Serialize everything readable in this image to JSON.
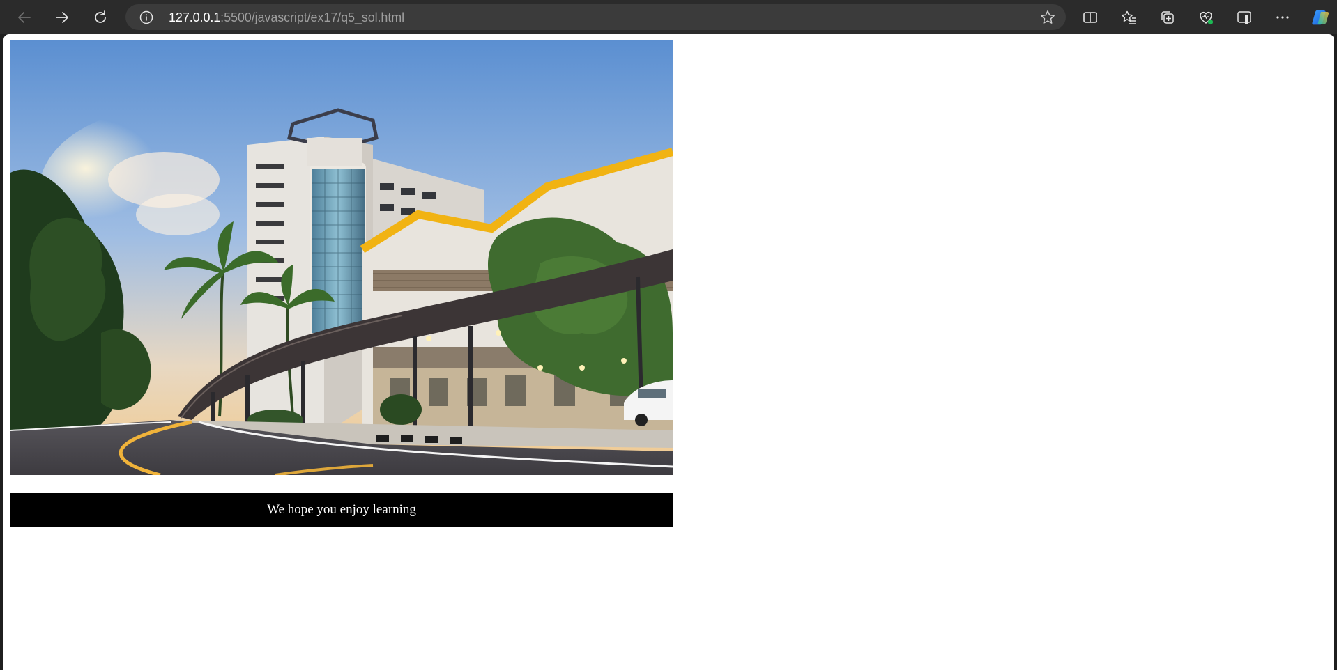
{
  "browser": {
    "url_host": "127.0.0.1",
    "url_path": ":5500/javascript/ex17/q5_sol.html",
    "icons": [
      "back-icon",
      "forward-icon",
      "refresh-icon",
      "info-icon",
      "star-icon",
      "split-screen-icon",
      "favorites-icon",
      "collections-icon",
      "browser-essentials-icon",
      "reading-view-icon",
      "more-icon",
      "copilot-icon"
    ],
    "colors": {
      "toolbar": "#2b2b2b",
      "addressbar": "#3b3b3b",
      "url_host": "#ffffff",
      "url_path": "#9e9e9e"
    }
  },
  "page": {
    "image": {
      "subject": "building-photo"
    },
    "caption": "We hope you enjoy learning",
    "colors": {
      "background": "#ffffff",
      "caption_bg": "#000000",
      "caption_text": "#ffffff"
    }
  }
}
